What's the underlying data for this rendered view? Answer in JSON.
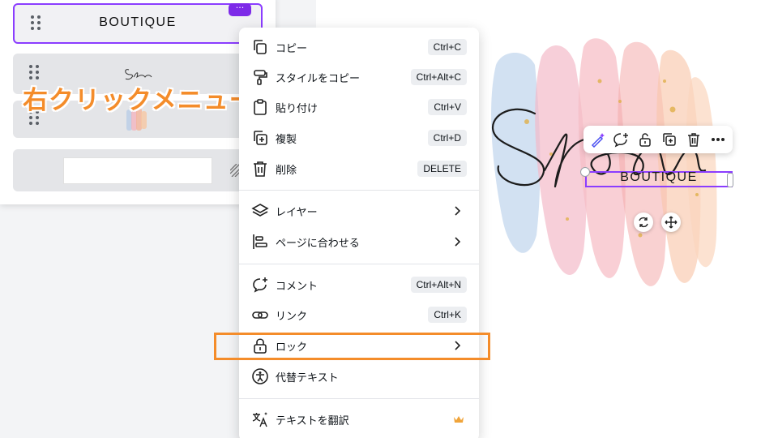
{
  "layers_panel": {
    "row1_text": "BOUTIQUE",
    "more_badge": "···"
  },
  "annotation": "右クリックメニュー",
  "context_menu": {
    "items": [
      {
        "label": "コピー",
        "shortcut": "Ctrl+C",
        "icon": "copy-icon"
      },
      {
        "label": "スタイルをコピー",
        "shortcut": "Ctrl+Alt+C",
        "icon": "paint-roller-icon"
      },
      {
        "label": "貼り付け",
        "shortcut": "Ctrl+V",
        "icon": "clipboard-icon"
      },
      {
        "label": "複製",
        "shortcut": "Ctrl+D",
        "icon": "duplicate-icon"
      },
      {
        "label": "削除",
        "shortcut": "DELETE",
        "icon": "trash-icon"
      },
      {
        "label": "レイヤー",
        "icon": "layers-icon"
      },
      {
        "label": "ページに合わせる",
        "icon": "align-icon"
      },
      {
        "label": "コメント",
        "shortcut": "Ctrl+Alt+N",
        "icon": "comment-icon"
      },
      {
        "label": "リンク",
        "shortcut": "Ctrl+K",
        "icon": "link-icon"
      },
      {
        "label": "ロック",
        "icon": "lock-icon"
      },
      {
        "label": "代替テキスト",
        "icon": "accessibility-icon"
      },
      {
        "label": "テキストを翻訳",
        "icon": "translate-icon",
        "badge": "crown-icon"
      }
    ]
  },
  "canvas": {
    "script_text": "Selena",
    "boutique_text": "BOUTIQUE"
  },
  "floating_toolbar": {
    "icons": [
      "magic-edit-icon",
      "comment-icon",
      "lock-icon",
      "duplicate-icon",
      "trash-icon",
      "more-icon"
    ]
  },
  "colors": {
    "accent": "#8b3dff",
    "annotation": "#f48c2a"
  }
}
